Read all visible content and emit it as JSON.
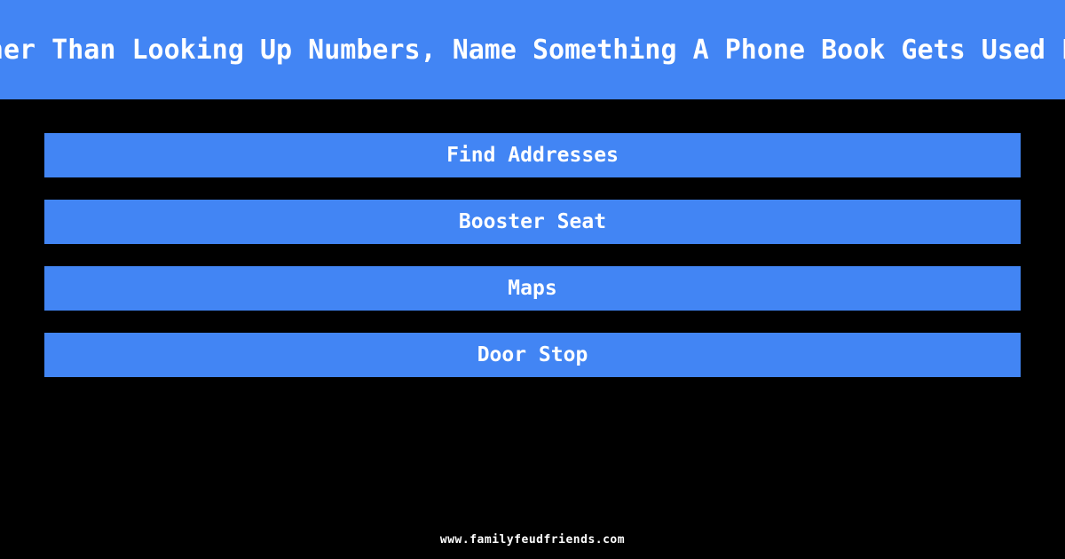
{
  "theme": {
    "background_color": "#000000",
    "accent_color": "#4285f4",
    "text_color": "#ffffff"
  },
  "header": {
    "question": "Other Than Looking Up Numbers, Name Something A Phone Book Gets Used For"
  },
  "answers": [
    {
      "label": "Find Addresses"
    },
    {
      "label": "Booster Seat"
    },
    {
      "label": "Maps"
    },
    {
      "label": "Door Stop"
    }
  ],
  "footer": {
    "site": "www.familyfeudfriends.com"
  }
}
